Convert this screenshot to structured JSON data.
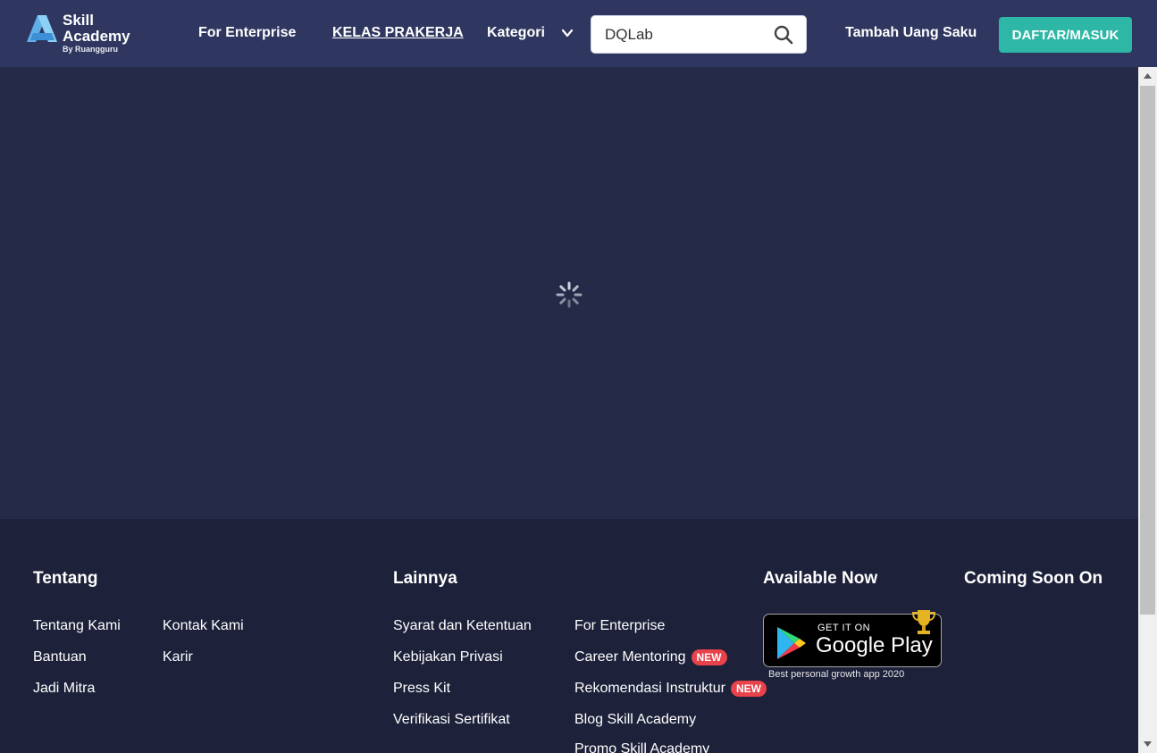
{
  "header": {
    "logo": {
      "line1": "Skill",
      "line2": "Academy",
      "line3": "By Ruangguru"
    },
    "nav": {
      "enterprise": "For Enterprise",
      "prakerja": "KELAS PRAKERJA",
      "kategori": "Kategori",
      "tambah": "Tambah Uang Saku"
    },
    "search": {
      "value": "DQLab",
      "icon": "search-icon"
    },
    "daftar_label": "DAFTAR/MASUK"
  },
  "main": {
    "loading_icon": "spinner-icon"
  },
  "footer": {
    "tentang": {
      "heading": "Tentang",
      "col1": [
        "Tentang Kami",
        "Bantuan",
        "Jadi Mitra"
      ],
      "col2": [
        "Kontak Kami",
        "Karir"
      ]
    },
    "lainnya": {
      "heading": "Lainnya",
      "col1": [
        "Syarat dan Ketentuan",
        "Kebijakan Privasi",
        "Press Kit",
        "Verifikasi Sertifikat"
      ],
      "col2": [
        "For Enterprise",
        "Career Mentoring",
        "Rekomendasi Instruktur",
        "Blog Skill Academy",
        "Promo Skill Academy"
      ],
      "new_badge": "NEW"
    },
    "available": {
      "heading": "Available Now",
      "gplay_small": "GET IT ON",
      "gplay_big": "Google Play",
      "caption": "Best personal growth app 2020"
    },
    "coming": {
      "heading": "Coming Soon On"
    }
  },
  "colors": {
    "header_bg": "#2f3760",
    "main_bg": "#242a47",
    "footer_bg": "#1d213a",
    "accent": "#2eb7a6",
    "badge": "#e8424a"
  }
}
